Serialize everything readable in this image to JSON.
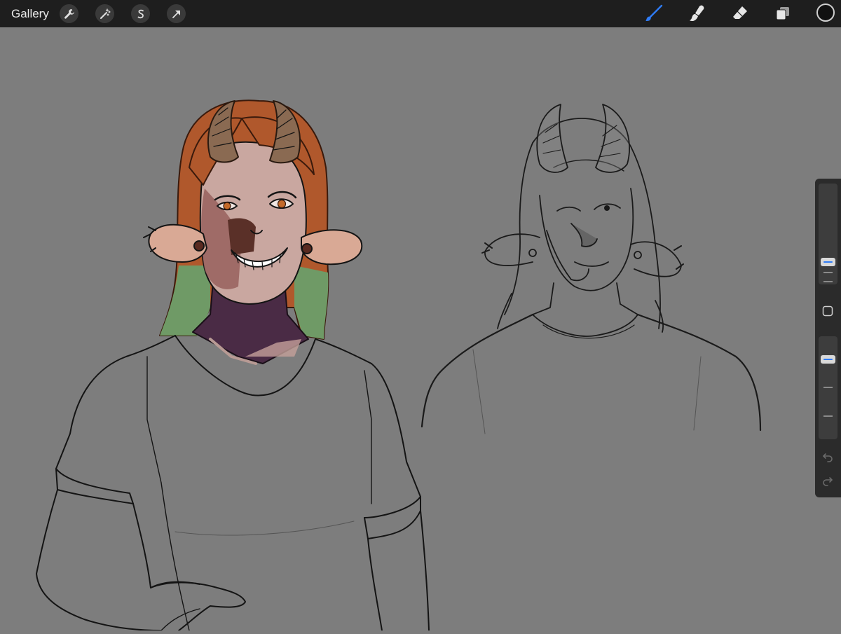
{
  "app": {
    "gallery_label": "Gallery"
  },
  "toolbar_left": [
    {
      "icon": "wrench-icon",
      "name": "actions-button"
    },
    {
      "icon": "magic-wand-icon",
      "name": "adjustments-button"
    },
    {
      "icon": "selection-icon",
      "name": "selection-button"
    },
    {
      "icon": "transform-arrow-icon",
      "name": "transform-button"
    }
  ],
  "toolbar_right": [
    {
      "icon": "brush-icon",
      "name": "brush-tool-button",
      "active": true
    },
    {
      "icon": "smudge-icon",
      "name": "smudge-tool-button",
      "active": false
    },
    {
      "icon": "eraser-icon",
      "name": "eraser-tool-button",
      "active": false
    },
    {
      "icon": "layers-icon",
      "name": "layers-button",
      "active": false
    }
  ],
  "colors": {
    "active_tool": "#2f7cf6",
    "current_color": "#111111",
    "topbar": "#1e1e1e",
    "canvas_bg": "#7d7d7d"
  },
  "sidebar": {
    "brush_size_level": 0.75,
    "opacity_level": 0.25
  }
}
